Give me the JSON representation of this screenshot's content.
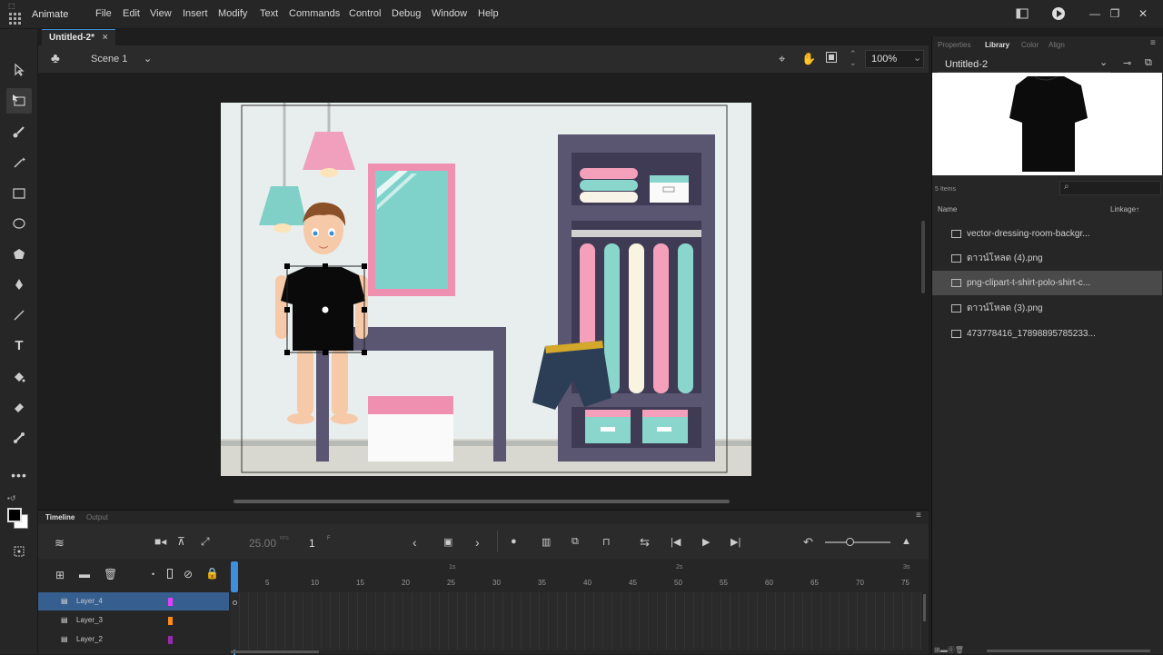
{
  "app": {
    "name": "Animate"
  },
  "menu": [
    "File",
    "Edit",
    "View",
    "Insert",
    "Modify",
    "Text",
    "Commands",
    "Control",
    "Debug",
    "Window",
    "Help"
  ],
  "document": {
    "tab": "Untitled-2*",
    "close": "×"
  },
  "editbar": {
    "scene": "Scene 1",
    "zoom": "100%"
  },
  "right_panel": {
    "tabs": [
      "Properties",
      "Library",
      "Color",
      "Align"
    ],
    "library_doc": "Untitled-2",
    "item_count": "5 Items",
    "col_name": "Name",
    "col_linkage": "Linkage",
    "items": [
      "vector-dressing-room-backgr...",
      "ดาวน์โหลด (4).png",
      "png-clipart-t-shirt-polo-shirt-c...",
      "ดาวน์โหลด (3).png",
      "473778416_17898895785233..."
    ],
    "selected_index": 2
  },
  "timeline": {
    "tabs": [
      "Timeline",
      "Output"
    ],
    "fps": "25.00",
    "fps_unit": "FPS",
    "frame": "1",
    "frame_unit": "F",
    "ruler_seconds": [
      "1s",
      "2s",
      "3s"
    ],
    "ruler_frames": [
      "5",
      "10",
      "15",
      "20",
      "25",
      "30",
      "35",
      "40",
      "45",
      "50",
      "55",
      "60",
      "65",
      "70",
      "75"
    ],
    "layers": [
      {
        "name": "Layer_4",
        "color": "#e040fb",
        "selected": true
      },
      {
        "name": "Layer_3",
        "color": "#ff8c1a",
        "selected": false
      },
      {
        "name": "Layer_2",
        "color": "#9c27b0",
        "selected": false
      }
    ]
  },
  "colors": {
    "accent": "#3f8edb",
    "selected_layer": "#365f8f"
  }
}
